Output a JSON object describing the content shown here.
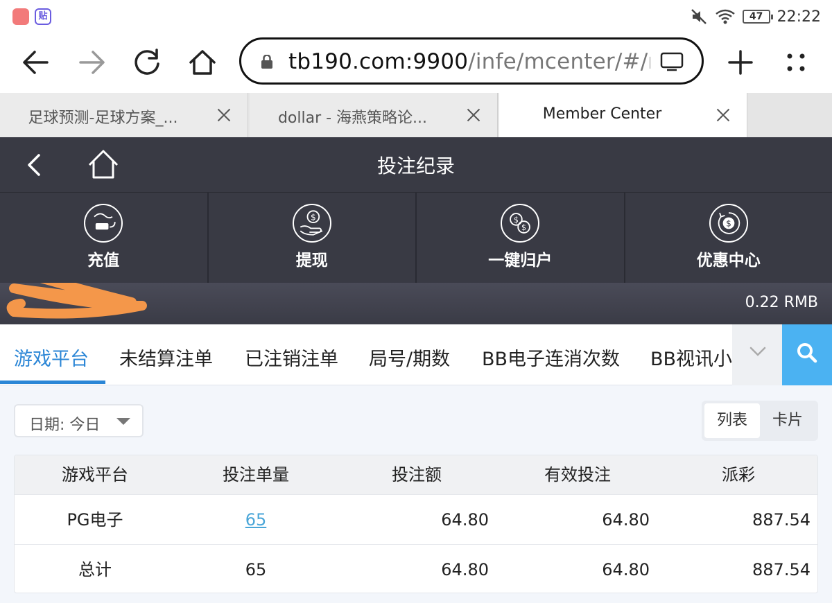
{
  "status_bar": {
    "time": "22:22",
    "battery": "47"
  },
  "browser": {
    "url_host": "tb190.com:9900",
    "url_path": "/infe/mcenter/#/mo",
    "tabs": [
      {
        "title": "足球预测-足球方案_..."
      },
      {
        "title": "dollar - 海燕策略论..."
      },
      {
        "title": "Member Center"
      }
    ]
  },
  "header": {
    "title": "投注纪录"
  },
  "quick_actions": [
    {
      "label": "充值",
      "icon": "deposit-icon"
    },
    {
      "label": "提现",
      "icon": "withdraw-icon"
    },
    {
      "label": "一键归户",
      "icon": "transfer-icon"
    },
    {
      "label": "优惠中心",
      "icon": "promo-icon"
    }
  ],
  "balance": {
    "amount": "0.22 RMB"
  },
  "categories": [
    {
      "label": "游戏平台",
      "active": true
    },
    {
      "label": "未结算注单"
    },
    {
      "label": "已注销注单"
    },
    {
      "label": "局号/期数"
    },
    {
      "label": "BB电子连消次数"
    },
    {
      "label": "BB视讯小"
    }
  ],
  "filter": {
    "date_label": "日期: 今日"
  },
  "view_toggle": {
    "list": "列表",
    "card": "卡片"
  },
  "table": {
    "headers": [
      "游戏平台",
      "投注单量",
      "投注额",
      "有效投注",
      "派彩"
    ],
    "rows": [
      [
        "PG电子",
        "65",
        "64.80",
        "64.80",
        "887.54"
      ],
      [
        "总计",
        "65",
        "64.80",
        "64.80",
        "887.54"
      ]
    ]
  },
  "colors": {
    "header_bg": "#393a44",
    "accent": "#2b86d6",
    "search_bg": "#4bb2f2"
  }
}
